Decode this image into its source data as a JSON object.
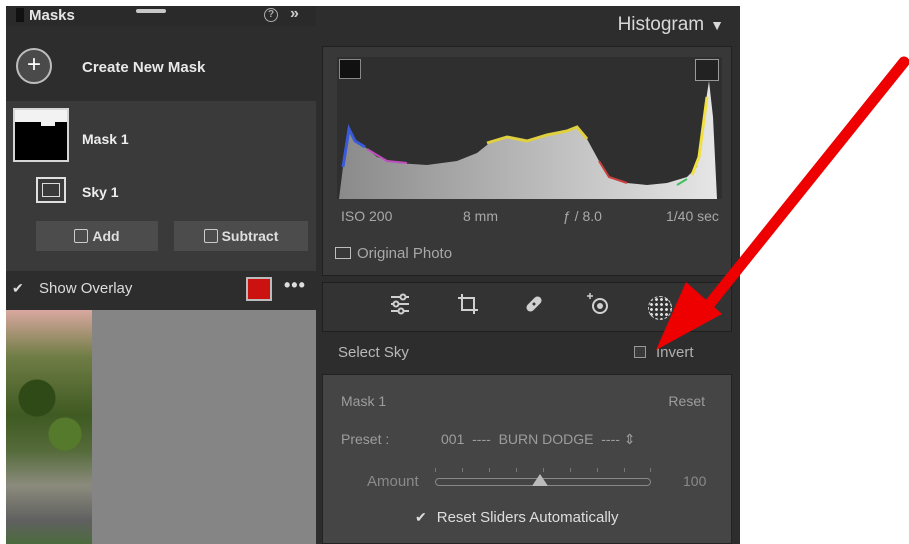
{
  "masks_panel": {
    "title": "Masks",
    "help_glyph": "?",
    "collapse_glyph": "»",
    "create_new_mask": "Create New Mask",
    "mask_name": "Mask 1",
    "component_name": "Sky 1",
    "add_label": "Add",
    "subtract_label": "Subtract",
    "show_overlay_label": "Show Overlay",
    "show_overlay_checked": true,
    "overlay_color": "#cc1111",
    "more_glyph": "•••"
  },
  "histogram": {
    "title": "Histogram",
    "iso": "ISO 200",
    "focal_length": "8 mm",
    "aperture": "ƒ / 8.0",
    "shutter": "1/40 sec",
    "original_photo_label": "Original Photo"
  },
  "tools": [
    {
      "name": "edit-sliders-icon",
      "glyph": "⚌"
    },
    {
      "name": "crop-icon",
      "glyph": "⌗"
    },
    {
      "name": "healing-icon",
      "glyph": "✎"
    },
    {
      "name": "red-eye-icon",
      "glyph": "◉"
    },
    {
      "name": "masking-icon",
      "glyph": ""
    }
  ],
  "mask_panel": {
    "select_label": "Select Sky",
    "invert_label": "Invert",
    "invert_checked": false,
    "mask_title": "Mask 1",
    "reset_label": "Reset",
    "preset_label": "Preset :",
    "preset_value": "001  ----  BURN DODGE  ---- ⇕",
    "amount_label": "Amount",
    "amount_value": "100",
    "reset_sliders_label": "Reset Sliders Automatically",
    "reset_sliders_checked": true
  },
  "annotation": {
    "arrow_color": "#ee0000"
  }
}
